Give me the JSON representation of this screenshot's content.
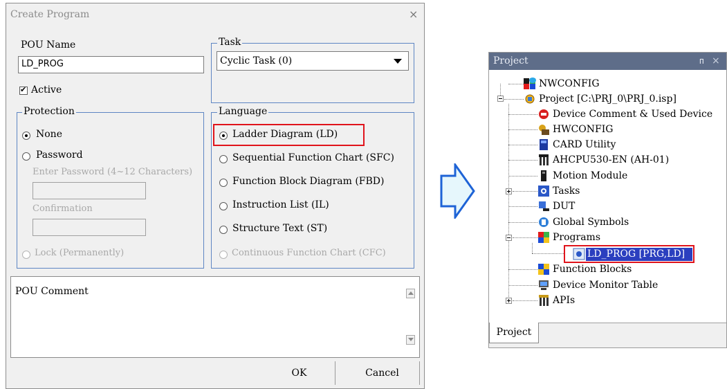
{
  "dialog": {
    "title": "Create Program",
    "close_glyph": "×",
    "pou_name": {
      "label": "POU Name",
      "value": "LD_PROG"
    },
    "active": {
      "label": "Active",
      "checked": true,
      "check_glyph": "✔"
    },
    "task": {
      "label": "Task",
      "selected": "Cyclic Task (0)"
    },
    "protection": {
      "label": "Protection",
      "none_label": "None",
      "password_label": "Password",
      "enter_password_label": "Enter Password (4~12 Characters)",
      "confirmation_label": "Confirmation",
      "lock_label": "Lock (Permanently)",
      "selected": "None"
    },
    "language": {
      "label": "Language",
      "options": [
        "Ladder Diagram (LD)",
        "Sequential Function Chart (SFC)",
        "Function Block Diagram (FBD)",
        "Instruction List (IL)",
        "Structure Text (ST)",
        "Continuous Function Chart (CFC)"
      ],
      "selected": "Ladder Diagram (LD)"
    },
    "comment": {
      "label": "POU Comment",
      "value": ""
    },
    "buttons": {
      "ok": "OK",
      "cancel": "Cancel"
    }
  },
  "project_panel": {
    "title": "Project",
    "pin_glyph": "ᴨ",
    "close_glyph": "×",
    "tree": {
      "nwconfig": "NWCONFIG",
      "project": "Project [C:\\PRJ_0\\PRJ_0.isp]",
      "device_comment": "Device Comment & Used Device",
      "hwconfig": "HWCONFIG",
      "card_utility": "CARD Utility",
      "cpu": "AHCPU530-EN  (AH-01)",
      "motion_module": "Motion Module",
      "tasks": "Tasks",
      "dut": "DUT",
      "global_symbols": "Global Symbols",
      "programs": "Programs",
      "ld_prog": "LD_PROG [PRG,LD]",
      "function_blocks": "Function Blocks",
      "device_monitor_table": "Device Monitor Table",
      "apis": "APIs"
    },
    "tab_label": "Project"
  },
  "colors": {
    "highlight_red": "#e0131b",
    "arrow_blue": "#1e63d6",
    "arrow_fill": "#e6f7fc",
    "panel_header": "#5e6d89",
    "selection_blue": "#2b3fbf"
  }
}
